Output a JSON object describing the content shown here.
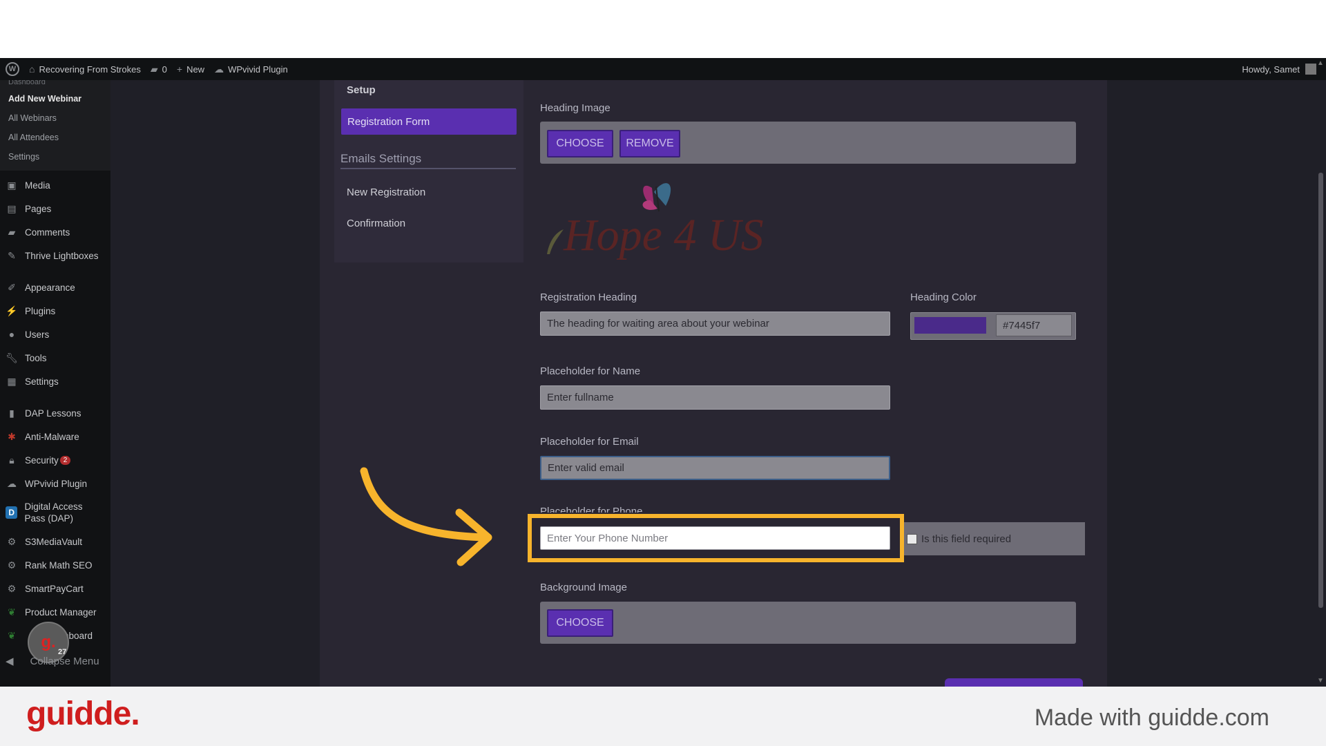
{
  "admin_bar": {
    "site_name": "Recovering From Strokes",
    "comments_count": "0",
    "new_label": "New",
    "plugin_label": "WPvivid Plugin",
    "greeting": "Howdy, Samet"
  },
  "sidebar": {
    "cut_item": "Dashboard",
    "sub_items": [
      "Add New Webinar",
      "All Webinars",
      "All Attendees",
      "Settings"
    ],
    "items": [
      {
        "label": "Media",
        "icon": "media-icon"
      },
      {
        "label": "Pages",
        "icon": "pages-icon"
      },
      {
        "label": "Comments",
        "icon": "comments-icon"
      },
      {
        "label": "Thrive Lightboxes",
        "icon": "pin-icon"
      },
      {
        "label": "Appearance",
        "icon": "brush-icon"
      },
      {
        "label": "Plugins",
        "icon": "plug-icon"
      },
      {
        "label": "Users",
        "icon": "users-icon"
      },
      {
        "label": "Tools",
        "icon": "wrench-icon"
      },
      {
        "label": "Settings",
        "icon": "settings-icon"
      },
      {
        "label": "DAP Lessons",
        "icon": "book-icon"
      },
      {
        "label": "Anti-Malware",
        "icon": "bug-icon"
      },
      {
        "label": "Security",
        "icon": "lock-icon",
        "badge": "2"
      },
      {
        "label": "WPvivid Plugin",
        "icon": "cloud-icon"
      },
      {
        "label": "Digital Access Pass (DAP)",
        "icon": "dap-icon"
      },
      {
        "label": "S3MediaVault",
        "icon": "gear-icon"
      },
      {
        "label": "Rank Math SEO",
        "icon": "gear-icon"
      },
      {
        "label": "SmartPayCart",
        "icon": "gear-icon"
      },
      {
        "label": "Product Manager",
        "icon": "leaf-icon"
      },
      {
        "label": "hboard",
        "icon": "leaf-icon"
      }
    ],
    "collapse_label": "Collapse Menu",
    "bubble_letter": "g.",
    "bubble_count": "27"
  },
  "settings_nav": {
    "setup": "Setup",
    "registration_form": "Registration Form",
    "emails_heading": "Emails Settings",
    "new_registration": "New Registration",
    "confirmation": "Confirmation"
  },
  "form": {
    "heading_image_label": "Heading Image",
    "choose_label": "CHOOSE",
    "remove_label": "REMOVE",
    "registration_heading_label": "Registration Heading",
    "registration_heading_value": "The heading for waiting area about your webinar",
    "heading_color_label": "Heading Color",
    "heading_color_hex": "#7445f7",
    "name_label": "Placeholder for Name",
    "name_value": "Enter fullname",
    "email_label": "Placeholder for Email",
    "email_value": "Enter valid email",
    "phone_label": "Placeholder for Phone",
    "phone_value": "Enter Your Phone Number",
    "required_label": "Is this field required",
    "background_image_label": "Background Image",
    "logo_text": "Hope 4 US"
  },
  "footer": {
    "brand": "guidde.",
    "made_with": "Made with guidde.com"
  }
}
